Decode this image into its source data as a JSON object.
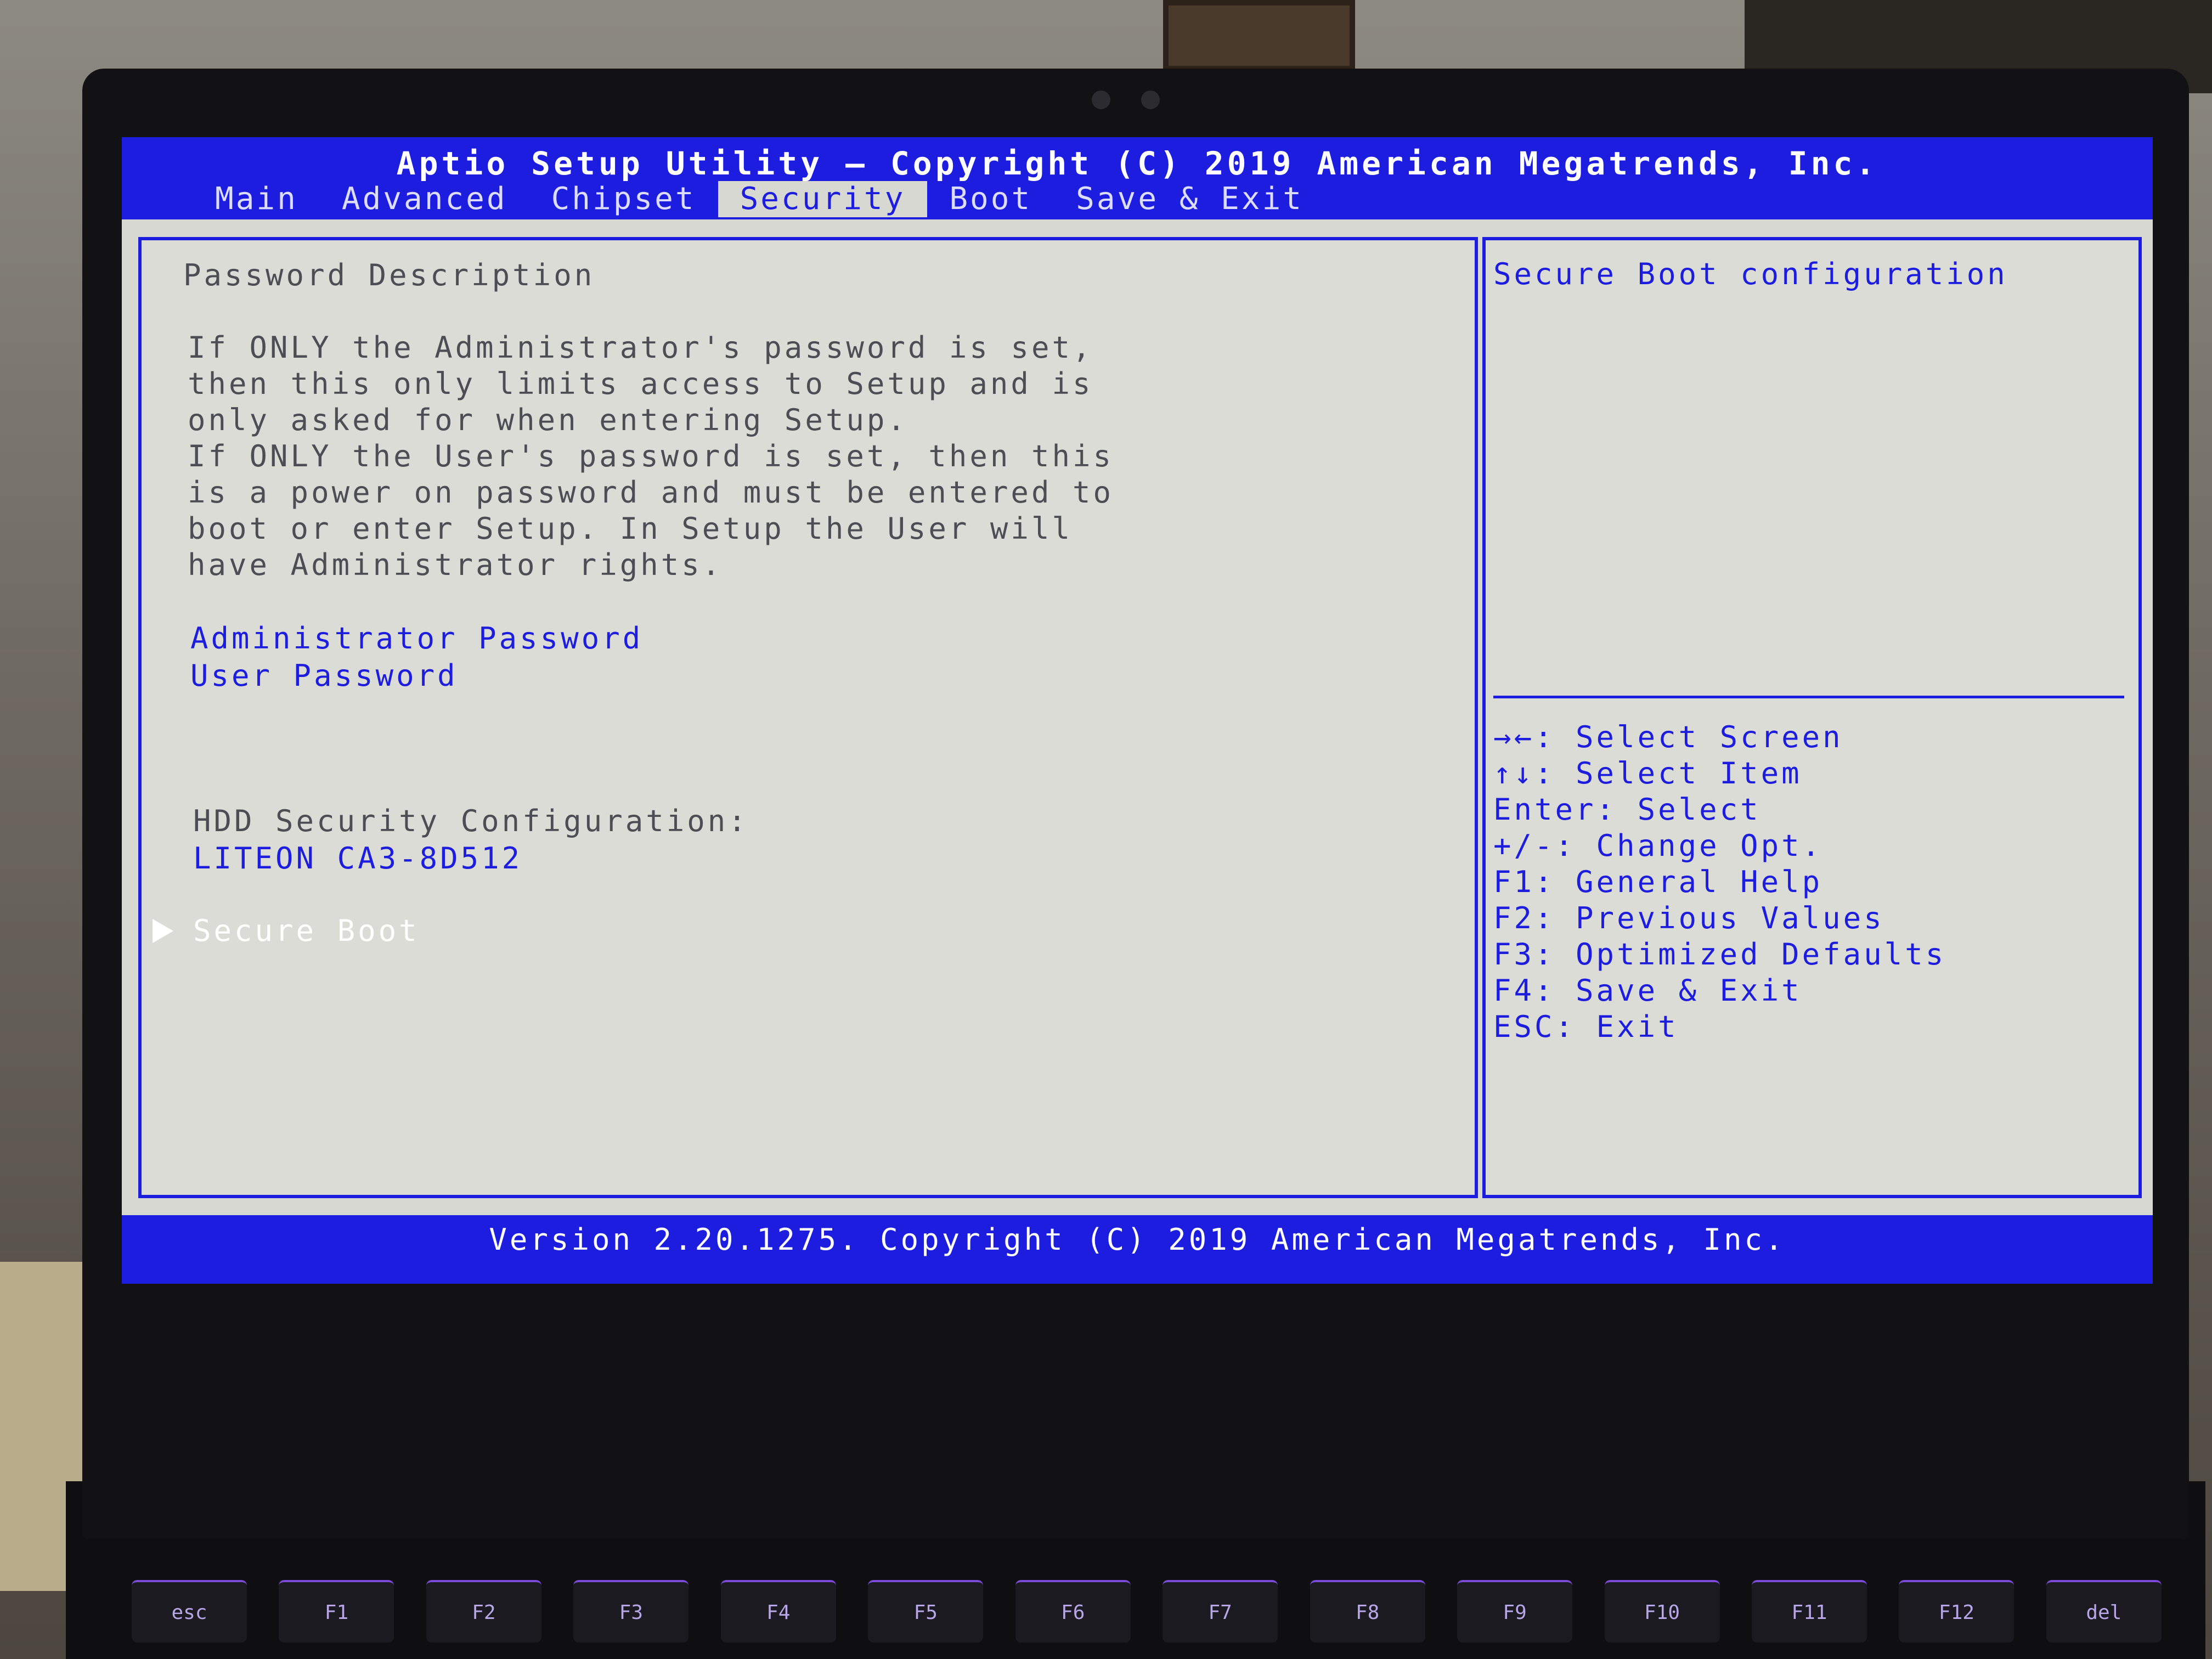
{
  "header": {
    "title": "Aptio Setup Utility – Copyright (C) 2019 American Megatrends, Inc.",
    "tabs": [
      {
        "label": "Main"
      },
      {
        "label": "Advanced"
      },
      {
        "label": "Chipset"
      },
      {
        "label": "Security"
      },
      {
        "label": "Boot"
      },
      {
        "label": "Save & Exit"
      }
    ],
    "active_tab": "Security"
  },
  "main": {
    "heading": "Password Description",
    "description": [
      "If ONLY the Administrator's password is set,",
      "then this only limits access to Setup and is",
      "only asked for when entering Setup.",
      "If ONLY the User's password is set, then this",
      "is a power on password and must be entered to",
      "boot or enter Setup. In Setup the User will",
      "have Administrator rights."
    ],
    "admin_password_label": "Administrator Password",
    "user_password_label": "User Password",
    "hdd_heading": "HDD Security Configuration:",
    "hdd_device": "LITEON CA3-8D512",
    "secure_boot_label": "Secure Boot"
  },
  "help": {
    "item_help": "Secure Boot configuration",
    "keys": [
      "→←: Select Screen",
      "↑↓: Select Item",
      "Enter: Select",
      "+/-: Change Opt.",
      "F1: General Help",
      "F2: Previous Values",
      "F3: Optimized Defaults",
      "F4: Save & Exit",
      "ESC: Exit"
    ]
  },
  "footer": {
    "text": "Version 2.20.1275. Copyright (C) 2019 American Megatrends, Inc."
  },
  "keyboard": {
    "keys": [
      "esc",
      "F1",
      "F2",
      "F3",
      "F4",
      "F5",
      "F6",
      "F7",
      "F8",
      "F9",
      "F10",
      "F11",
      "F12",
      "del"
    ]
  },
  "colors": {
    "bios_blue": "#1d1de0",
    "bios_background": "#d8d8d2",
    "text_gray": "#4d4d56",
    "keyboard_backlight": "#7b4ad6"
  }
}
